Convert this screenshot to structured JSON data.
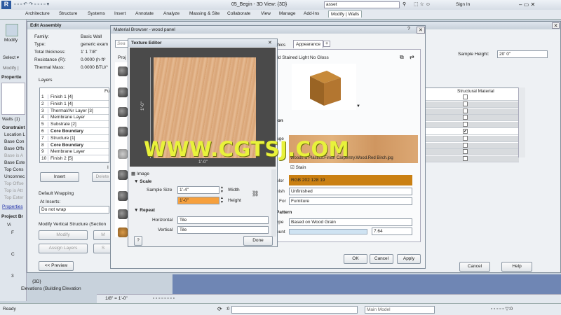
{
  "app": {
    "title": "05_Begin - 3D View: {3D}",
    "search_value": "asset",
    "sign_in": "Sign In"
  },
  "ribbon_tabs": [
    "Architecture",
    "Structure",
    "Systems",
    "Insert",
    "Annotate",
    "Analyze",
    "Massing & Site",
    "Collaborate",
    "View",
    "Manage",
    "Add-Ins",
    "Modify | Walls"
  ],
  "left": {
    "modify": "Modify",
    "select": "Select ▾",
    "modify_short": "Modify |",
    "properties": "Propertie",
    "walls": "Walls (1)",
    "constraints": "Constraint",
    "items": [
      "Location L",
      "Base Con",
      "Base Offs",
      "Base is A",
      "Base Exte",
      "Top Cons",
      "Unconnec",
      "Top Offse",
      "Top is Att",
      "Top Exter"
    ],
    "properties_link": "Properties",
    "project_browser": "Project Br",
    "tree": [
      "Vi",
      "F",
      "C",
      "3"
    ],
    "tree_3d": "{3D}",
    "elevations": "Elevations (Building Elevation"
  },
  "edit_assembly": {
    "title": "Edit Assembly",
    "family_label": "Family:",
    "family": "Basic Wall",
    "type_label": "Type:",
    "type": "generic exam",
    "thickness_label": "Total thickness:",
    "thickness": "1'  1 7/8\"",
    "resistance_label": "Resistance (R):",
    "resistance": "0.0000 (h·ft²",
    "mass_label": "Thermal Mass:",
    "mass": "0.0000 BTU/°",
    "layers_label": "Layers",
    "fu_header": "Fu",
    "layers": [
      {
        "n": "1",
        "name": "Finish 1 [4]",
        "bold": false
      },
      {
        "n": "2",
        "name": "Finish 1 [4]",
        "bold": false
      },
      {
        "n": "3",
        "name": "Thermal/Air Layer [3]",
        "bold": false
      },
      {
        "n": "4",
        "name": "Membrane Layer",
        "bold": false
      },
      {
        "n": "5",
        "name": "Substrate [2]",
        "bold": false
      },
      {
        "n": "6",
        "name": "Core Boundary",
        "bold": true
      },
      {
        "n": "7",
        "name": "Structure [1]",
        "bold": false
      },
      {
        "n": "8",
        "name": "Core Boundary",
        "bold": true
      },
      {
        "n": "9",
        "name": "Membrane Layer",
        "bold": false
      },
      {
        "n": "10",
        "name": "Finish 2 [5]",
        "bold": false
      }
    ],
    "in_label": "I",
    "insert": "Insert",
    "delete": "Delete",
    "default_wrapping": "Default Wrapping",
    "at_inserts": "At Inserts:",
    "at_inserts_value": "Do not wrap",
    "modify_vertical": "Modify Vertical Structure (Section",
    "modify": "Modify",
    "m_short": "M",
    "assign_layers": "Assign Layers",
    "s_short": "S",
    "preview": "<< Preview",
    "sample_height_label": "Sample Height:",
    "sample_height": "20'  0\"",
    "structural_material": "Structural Material",
    "ok": "OK",
    "cancel": "Cancel",
    "help": "Help"
  },
  "material_browser": {
    "title": "Material Browser - wood panel",
    "search_placeholder": "Sea",
    "proj": "Proj",
    "tab_graphics": "phics",
    "tab_appearance": "Appearance",
    "tab_plus": "+",
    "asset_name": "ild Stained Light No Gloss",
    "section_label": "ion",
    "image_label": "age",
    "image_path": "Woods & Plastics.Finish Carpentry.Wood.Red Birch.jpg",
    "stain": "Stain",
    "color_label": "olor",
    "color_value": "RGB 202 128 19",
    "color_hex": "#ca8013",
    "finish_label": "nish",
    "finish_value": "Unfinished",
    "for_label": "For",
    "for_value": "Furniture",
    "pattern": "Pattern",
    "ype_label": "ype",
    "pattern_value": "Based on Wood Grain",
    "amount_label": "ount",
    "amount_value": "7.64",
    "ok": "OK",
    "cancel": "Cancel",
    "apply": "Apply"
  },
  "texture_editor": {
    "title": "Texture Editor",
    "ruler_v": "1'-0\"",
    "ruler_h": "1'-0\"",
    "image": "Image",
    "scale": "Scale",
    "sample_size_label": "Sample Size",
    "sample_size": "1'-4\"",
    "width_label": "Width",
    "height_value": "1'-0\"",
    "height_label": "Height",
    "repeat": "Repeat",
    "horizontal_label": "Horizontal",
    "horizontal_value": "Tile",
    "vertical_label": "Vertical",
    "vertical_value": "Tile",
    "help": "?",
    "done": "Done"
  },
  "watermark": "WWW.CGTSJ.COM",
  "status": {
    "ready": "Ready",
    "scale": "1/8\" = 1'-0\"",
    "main_model": "Main Model",
    "zero": ":0"
  }
}
